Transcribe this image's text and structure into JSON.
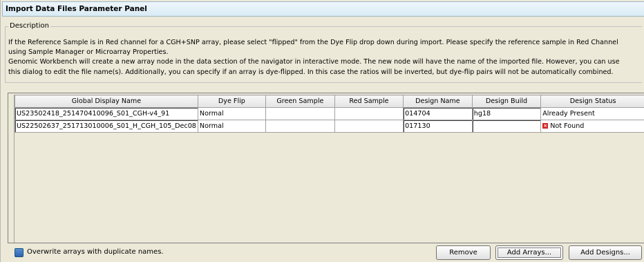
{
  "panel": {
    "title": "Import Data Files Parameter Panel"
  },
  "description": {
    "legend": "Description",
    "lines": [
      "If the Reference Sample is in Red channel for a CGH+SNP array, please select  \"flipped\" from the Dye Flip drop down during  import. Please specify the reference sample in Red Channel",
      "using Sample Manager or Microarray Properties.",
      "Genomic Workbench will create a new array node in the data section of the navigator in interactive mode. The new node will have the name of the imported file. However, you can use",
      "this dialog to edit the file name(s). Additionally, you can specify if an array is dye-flipped. In this case the ratios will be inverted, but dye-flip pairs will not be automatically combined."
    ]
  },
  "table": {
    "columns": [
      "Global Display Name",
      "Dye Flip",
      "Green Sample",
      "Red Sample",
      "Design Name",
      "Design Build",
      "Design Status"
    ],
    "rows": [
      {
        "global_display_name": "US23502418_251470410096_S01_CGH-v4_91",
        "dye_flip": "Normal",
        "green_sample": "",
        "red_sample": "",
        "design_name": "014704",
        "design_build": "hg18",
        "design_status": "Already Present"
      },
      {
        "global_display_name": "US22502637_251713010006_S01_H_CGH_105_Dec08",
        "dye_flip": "Normal",
        "green_sample": "",
        "red_sample": "",
        "design_name": "017130",
        "design_build": "",
        "design_status": "Not Found"
      }
    ]
  },
  "footer": {
    "overwrite_label": "Overwrite arrays with duplicate names.",
    "remove_label": "Remove",
    "add_arrays_label": "Add Arrays...",
    "add_designs_label": "Add Designs..."
  },
  "icons": {
    "not_found": "error-x-icon",
    "not_found_color": "#d62020",
    "checkbox_color": "#2b64b0"
  }
}
